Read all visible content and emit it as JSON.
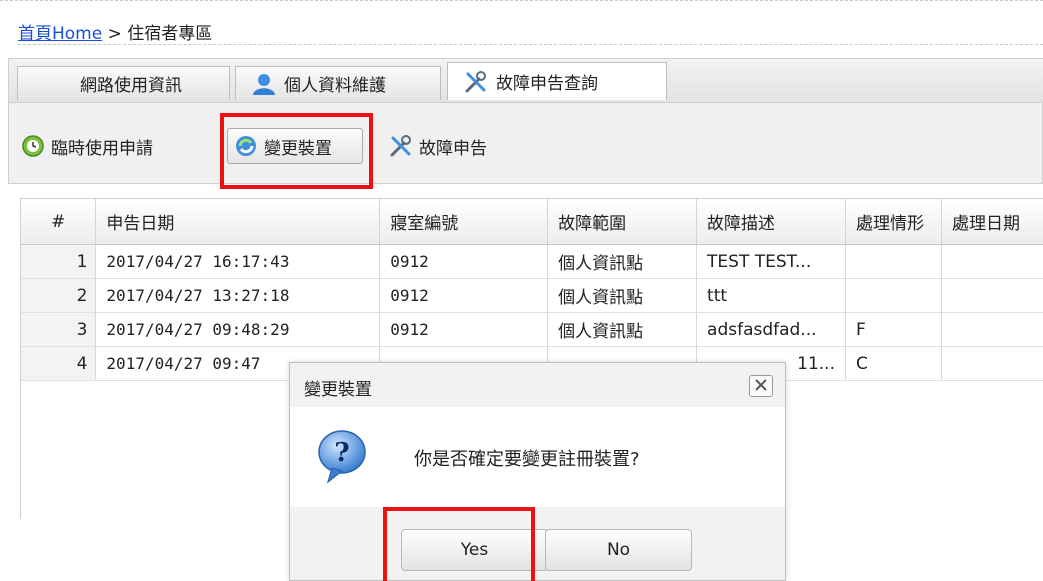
{
  "breadcrumb": {
    "home": "首頁Home",
    "separator": ">",
    "current": "住宿者專區"
  },
  "tabs": [
    {
      "label": "網路使用資訊",
      "icon": "none"
    },
    {
      "label": "個人資料維護",
      "icon": "user-icon"
    },
    {
      "label": "故障申告查詢",
      "icon": "tools-icon",
      "active": true
    }
  ],
  "toolbar": {
    "temp_apply": "臨時使用申請",
    "change_device": "變更裝置",
    "report_fault": "故障申告"
  },
  "grid": {
    "columns": [
      "#",
      "申告日期",
      "寢室編號",
      "故障範圍",
      "故障描述",
      "處理情形",
      "處理日期"
    ],
    "rows": [
      {
        "no": "1",
        "date": "2017/04/27 16:17:43",
        "room": "0912",
        "scope": "個人資訊點",
        "desc": "TEST TEST...",
        "status": "",
        "handled": ""
      },
      {
        "no": "2",
        "date": "2017/04/27 13:27:18",
        "room": "0912",
        "scope": "個人資訊點",
        "desc": "ttt",
        "status": "",
        "handled": ""
      },
      {
        "no": "3",
        "date": "2017/04/27 09:48:29",
        "room": "0912",
        "scope": "個人資訊點",
        "desc": "adsfasdfad...",
        "status": "F",
        "handled": ""
      },
      {
        "no": "4",
        "date": "2017/04/27 09:47",
        "room": "",
        "scope": "",
        "desc": "11...",
        "status": "C",
        "handled": ""
      }
    ]
  },
  "dialog": {
    "title": "變更裝置",
    "message": "你是否確定要變更註冊裝置?",
    "yes": "Yes",
    "no": "No"
  },
  "colors": {
    "highlight": "#ee1111",
    "link": "#1a4fd6"
  }
}
